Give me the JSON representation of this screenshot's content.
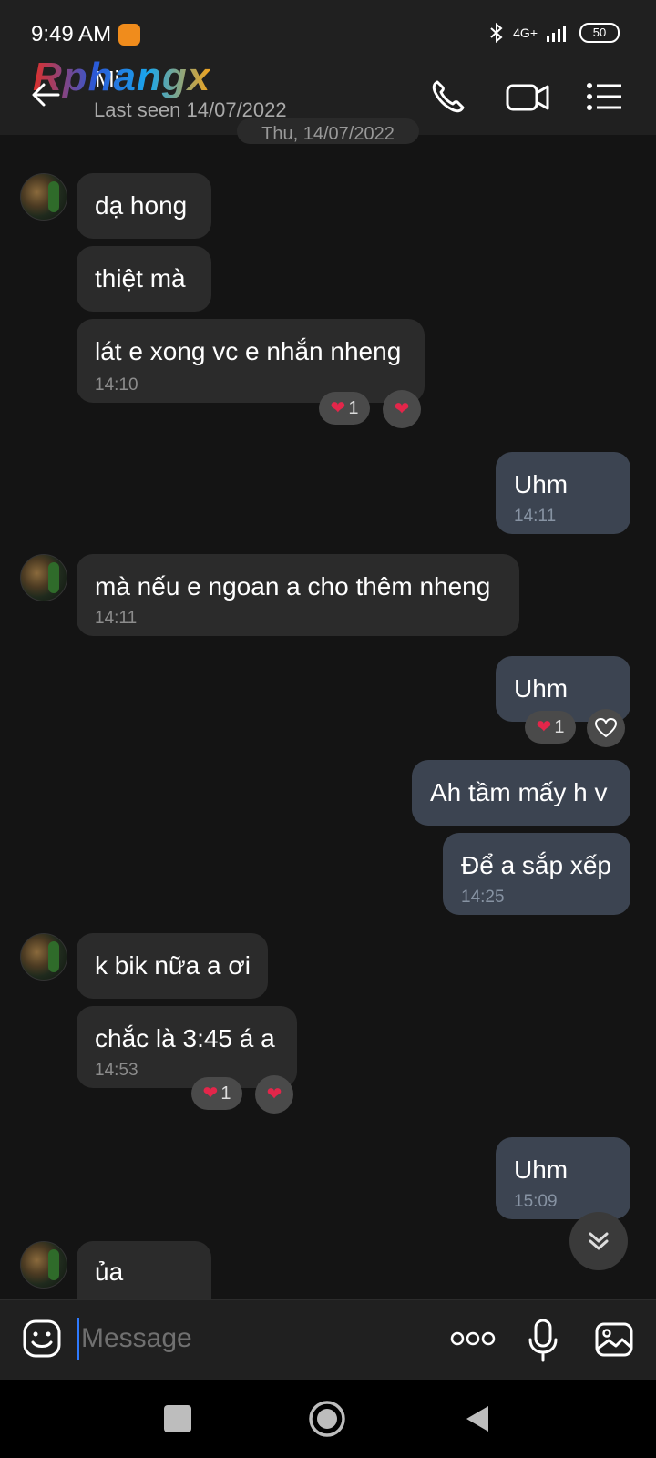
{
  "status_bar": {
    "time": "9:49 AM",
    "network": "4G+",
    "battery": "50"
  },
  "header": {
    "watermark": "Rphangx",
    "contact_name": "Mi",
    "last_seen": "Last seen 14/07/2022",
    "date_pill": "Thu, 14/07/2022"
  },
  "messages": [
    {
      "dir": "in",
      "text": "dạ hong"
    },
    {
      "dir": "in",
      "text": "thiệt mà"
    },
    {
      "dir": "in",
      "text": "lát e xong vc e nhắn nheng",
      "time": "14:10",
      "reaction_count": "1"
    },
    {
      "dir": "out",
      "text": "Uhm",
      "time": "14:11"
    },
    {
      "dir": "in",
      "text": "mà nếu e ngoan a cho thêm nheng",
      "time": "14:11"
    },
    {
      "dir": "out",
      "text": "Uhm",
      "reaction_count": "1"
    },
    {
      "dir": "out",
      "text": "Ah tầm mấy h v"
    },
    {
      "dir": "out",
      "text": "Để a sắp xếp",
      "time": "14:25"
    },
    {
      "dir": "in",
      "text": "k bik nữa a ơi"
    },
    {
      "dir": "in",
      "text": "chắc là 3:45 á a",
      "time": "14:53",
      "reaction_count": "1"
    },
    {
      "dir": "out",
      "text": "Uhm",
      "time": "15:09"
    },
    {
      "dir": "in",
      "text": "ủa"
    }
  ],
  "composer": {
    "placeholder": "Message"
  },
  "colors": {
    "incoming_bubble": "#2b2b2b",
    "outgoing_bubble": "#3c4451",
    "heart": "#e3264a",
    "accent": "#2f7bff"
  }
}
